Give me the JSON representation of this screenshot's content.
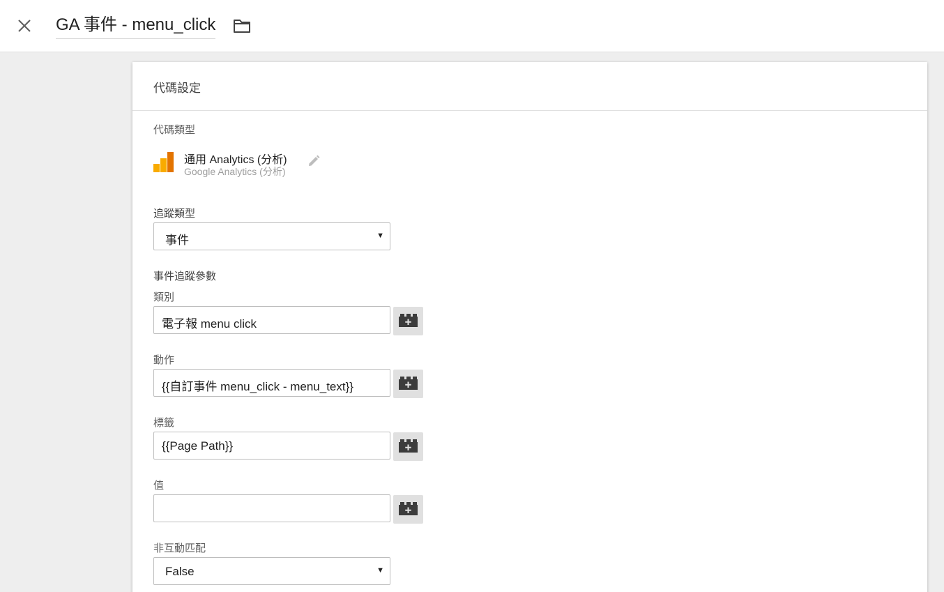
{
  "header": {
    "title": "GA 事件 - menu_click",
    "close_icon": "close-icon",
    "folder_icon": "folder-icon"
  },
  "card": {
    "title": "代碼設定"
  },
  "tag_type": {
    "label": "代碼類型",
    "name": "通用 Analytics (分析)",
    "subtitle": "Google Analytics (分析)",
    "icon": "google-analytics-icon",
    "edit_icon": "pencil-icon"
  },
  "track_type": {
    "label": "追蹤類型",
    "value": "事件"
  },
  "event_params": {
    "section_label": "事件追蹤參數",
    "category": {
      "label": "類別",
      "value": "電子報 menu click"
    },
    "action": {
      "label": "動作",
      "value": "{{自訂事件 menu_click - menu_text}}"
    },
    "tag_label": {
      "label": "標籤",
      "value": "{{Page Path}}"
    },
    "value": {
      "label": "值",
      "value": ""
    },
    "variable_icon": "add-variable-brick-icon"
  },
  "non_interaction": {
    "label": "非互動匹配",
    "value": "False"
  },
  "colors": {
    "analytics_orange": "#f9ab00",
    "analytics_dark_orange": "#e37400",
    "background": "#eeeeee",
    "card": "#ffffff"
  }
}
